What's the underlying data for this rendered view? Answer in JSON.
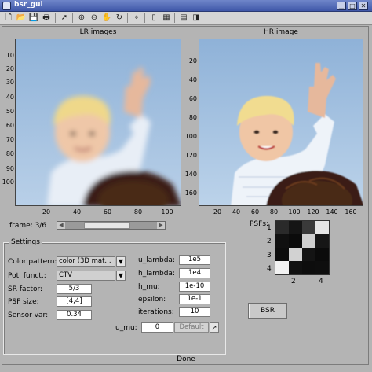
{
  "window": {
    "title": "bsr_gui"
  },
  "toolbar": {
    "icons": [
      "new-file-icon",
      "open-folder-icon",
      "save-icon",
      "print-icon",
      "pointer-icon",
      "zoom-in-icon",
      "zoom-out-icon",
      "pan-hand-icon",
      "rotate-icon",
      "data-cursor-icon",
      "colorbar-icon",
      "legend-icon",
      "hide-tools-icon",
      "dock-icon"
    ]
  },
  "lr_axes": {
    "title": "LR images",
    "yticks": [
      "10",
      "20",
      "30",
      "40",
      "50",
      "60",
      "70",
      "80",
      "90",
      "100"
    ],
    "xticks": [
      "20",
      "40",
      "60",
      "80",
      "100"
    ]
  },
  "hr_axes": {
    "title": "HR image",
    "yticks": [
      "20",
      "40",
      "60",
      "80",
      "100",
      "120",
      "140",
      "160"
    ],
    "xticks": [
      "20",
      "40",
      "60",
      "80",
      "100",
      "120",
      "140",
      "160"
    ]
  },
  "frame": {
    "label": "frame: 3/6",
    "current": 3,
    "total": 6
  },
  "psf": {
    "label": "PSFs:",
    "rows": [
      "1",
      "2",
      "3",
      "4"
    ],
    "cols": [
      "2",
      "4"
    ],
    "cells": [
      [
        "#2a2a2a",
        "#151515",
        "#3a3a3a",
        "#e6e6e6"
      ],
      [
        "#101010",
        "#0b0b0b",
        "#cfcfcf",
        "#161616"
      ],
      [
        "#0d0d0d",
        "#d2d2d2",
        "#141414",
        "#0b0b0b"
      ],
      [
        "#f2f2f2",
        "#111111",
        "#0d0d0d",
        "#0e0e0e"
      ]
    ]
  },
  "settings": {
    "title": "Settings",
    "color_pattern": {
      "label": "Color pattern:",
      "value": "color (3D mat..."
    },
    "pot_funct": {
      "label": "Pot. funct.:",
      "value": "CTV"
    },
    "sr_factor": {
      "label": "SR factor:",
      "value": "5/3"
    },
    "psf_size": {
      "label": "PSF size:",
      "value": "[4,4]"
    },
    "sensor_var": {
      "label": "Sensor var:",
      "value": "0.34"
    },
    "u_lambda": {
      "label": "u_lambda:",
      "value": "1e5"
    },
    "h_lambda": {
      "label": "h_lambda:",
      "value": "1e4"
    },
    "h_mu": {
      "label": "h_mu:",
      "value": "1e-10"
    },
    "epsilon": {
      "label": "epsilon:",
      "value": "1e-1"
    },
    "iterations": {
      "label": "iterations:",
      "value": "10"
    },
    "u_mu": {
      "label": "u_mu:",
      "value": "0",
      "default_label": "Default"
    }
  },
  "bsr_button": "BSR",
  "status": "Done",
  "dropdown_arrow": "▼",
  "edit_arrow": "↗"
}
